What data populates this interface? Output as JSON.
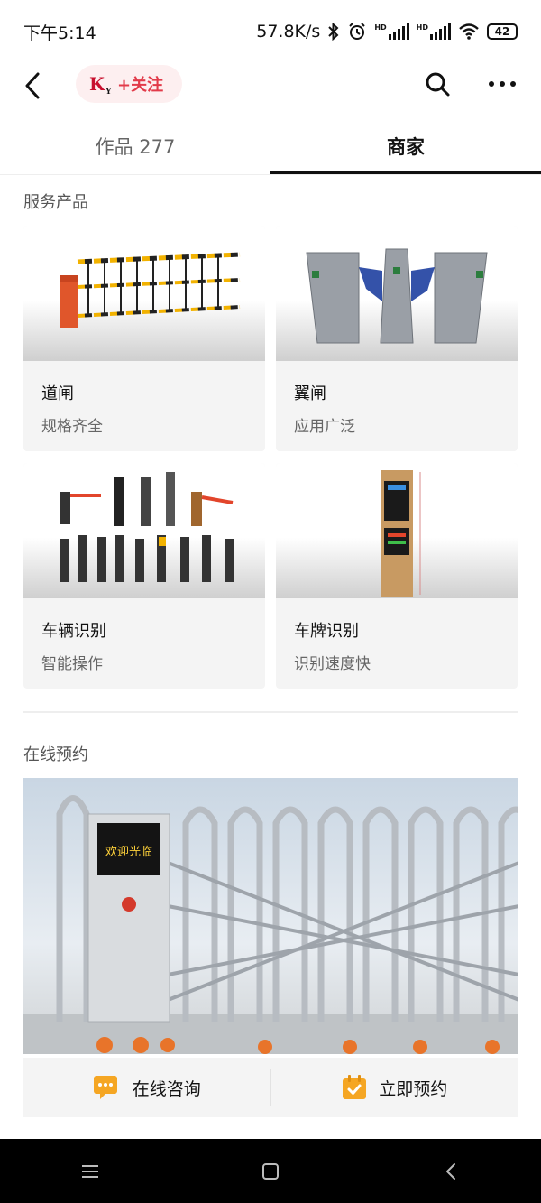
{
  "status_bar": {
    "time": "下午5:14",
    "speed": "57.8K/s",
    "battery": "42",
    "hd1": "HD",
    "hd2": "HD"
  },
  "nav": {
    "logo_text": "K",
    "logo_sub": "Y",
    "follow_label": "+关注"
  },
  "tabs": [
    {
      "label": "作品 277",
      "active": false
    },
    {
      "label": "商家",
      "active": true
    }
  ],
  "services": {
    "title": "服务产品",
    "items": [
      {
        "name": "道闸",
        "desc": "规格齐全"
      },
      {
        "name": "翼闸",
        "desc": "应用广泛"
      },
      {
        "name": "车辆识别",
        "desc": "智能操作"
      },
      {
        "name": "车牌识别",
        "desc": "识别速度快"
      }
    ]
  },
  "booking": {
    "title": "在线预约",
    "gate_sign": "欢迎光临",
    "consult_label": "在线咨询",
    "reserve_label": "立即预约"
  },
  "colors": {
    "accent": "#e23b4a",
    "follow_bg": "#fdeff0",
    "icon_orange": "#f5a623"
  },
  "icons": [
    "back-arrow-icon",
    "search-icon",
    "more-icon",
    "chat-icon",
    "calendar-check-icon",
    "menu-icon",
    "home-square-icon",
    "back-triangle-icon"
  ]
}
